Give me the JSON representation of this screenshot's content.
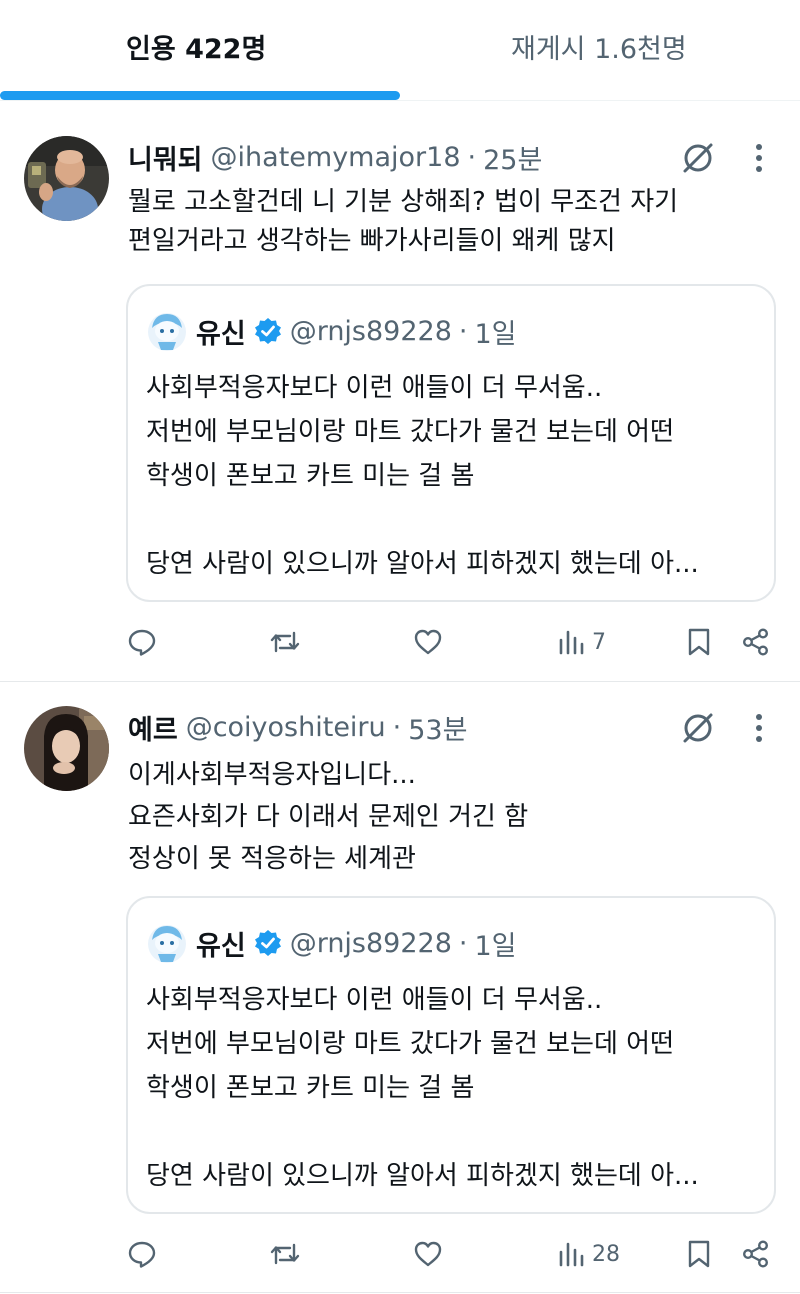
{
  "tabs": [
    {
      "label": "인용 422명",
      "active": true
    },
    {
      "label": "재게시 1.6천명",
      "active": false
    }
  ],
  "accent_color": "#1d9bf0",
  "tweets": [
    {
      "display_name": "니뭐되",
      "handle": "@ihatemymajor18",
      "separator": "·",
      "time": "25분",
      "text_lines": [
        "뭘로 고소할건데 니 기분 상해죄? 법이 무조건 자기",
        "편일거라고 생각하는 빠가사리들이 왜케 많지"
      ],
      "quoted": {
        "display_name": "유신",
        "verified": true,
        "handle": "@rnjs89228",
        "separator": "·",
        "time": "1일",
        "text_lines": [
          "사회부적응자보다 이런 애들이 더 무서움..",
          "저번에 부모님이랑 마트 갔다가 물건 보는데 어떤",
          "학생이 폰보고 카트 미는 걸 봄",
          "당연 사람이 있으니까 알아서 피하겠지 했는데 아..."
        ]
      },
      "views": "7"
    },
    {
      "display_name": "예르",
      "handle": "@coiyoshiteiru",
      "separator": "·",
      "time": "53분",
      "text_lines": [
        "이게사회부적응자입니다...",
        "요즌사회가 다 이래서 문제인 거긴 함",
        "정상이 못 적응하는 세계관"
      ],
      "quoted": {
        "display_name": "유신",
        "verified": true,
        "handle": "@rnjs89228",
        "separator": "·",
        "time": "1일",
        "text_lines": [
          "사회부적응자보다 이런 애들이 더 무서움..",
          "저번에 부모님이랑 마트 갔다가 물건 보는데 어떤",
          "학생이 폰보고 카트 미는 걸 봄",
          "당연 사람이 있으니까 알아서 피하겠지 했는데 아..."
        ]
      },
      "views": "28"
    }
  ],
  "icons": [
    "grok-icon",
    "more-icon",
    "reply-icon",
    "repost-icon",
    "like-icon",
    "views-icon",
    "bookmark-icon",
    "share-icon",
    "verified-badge-icon"
  ]
}
